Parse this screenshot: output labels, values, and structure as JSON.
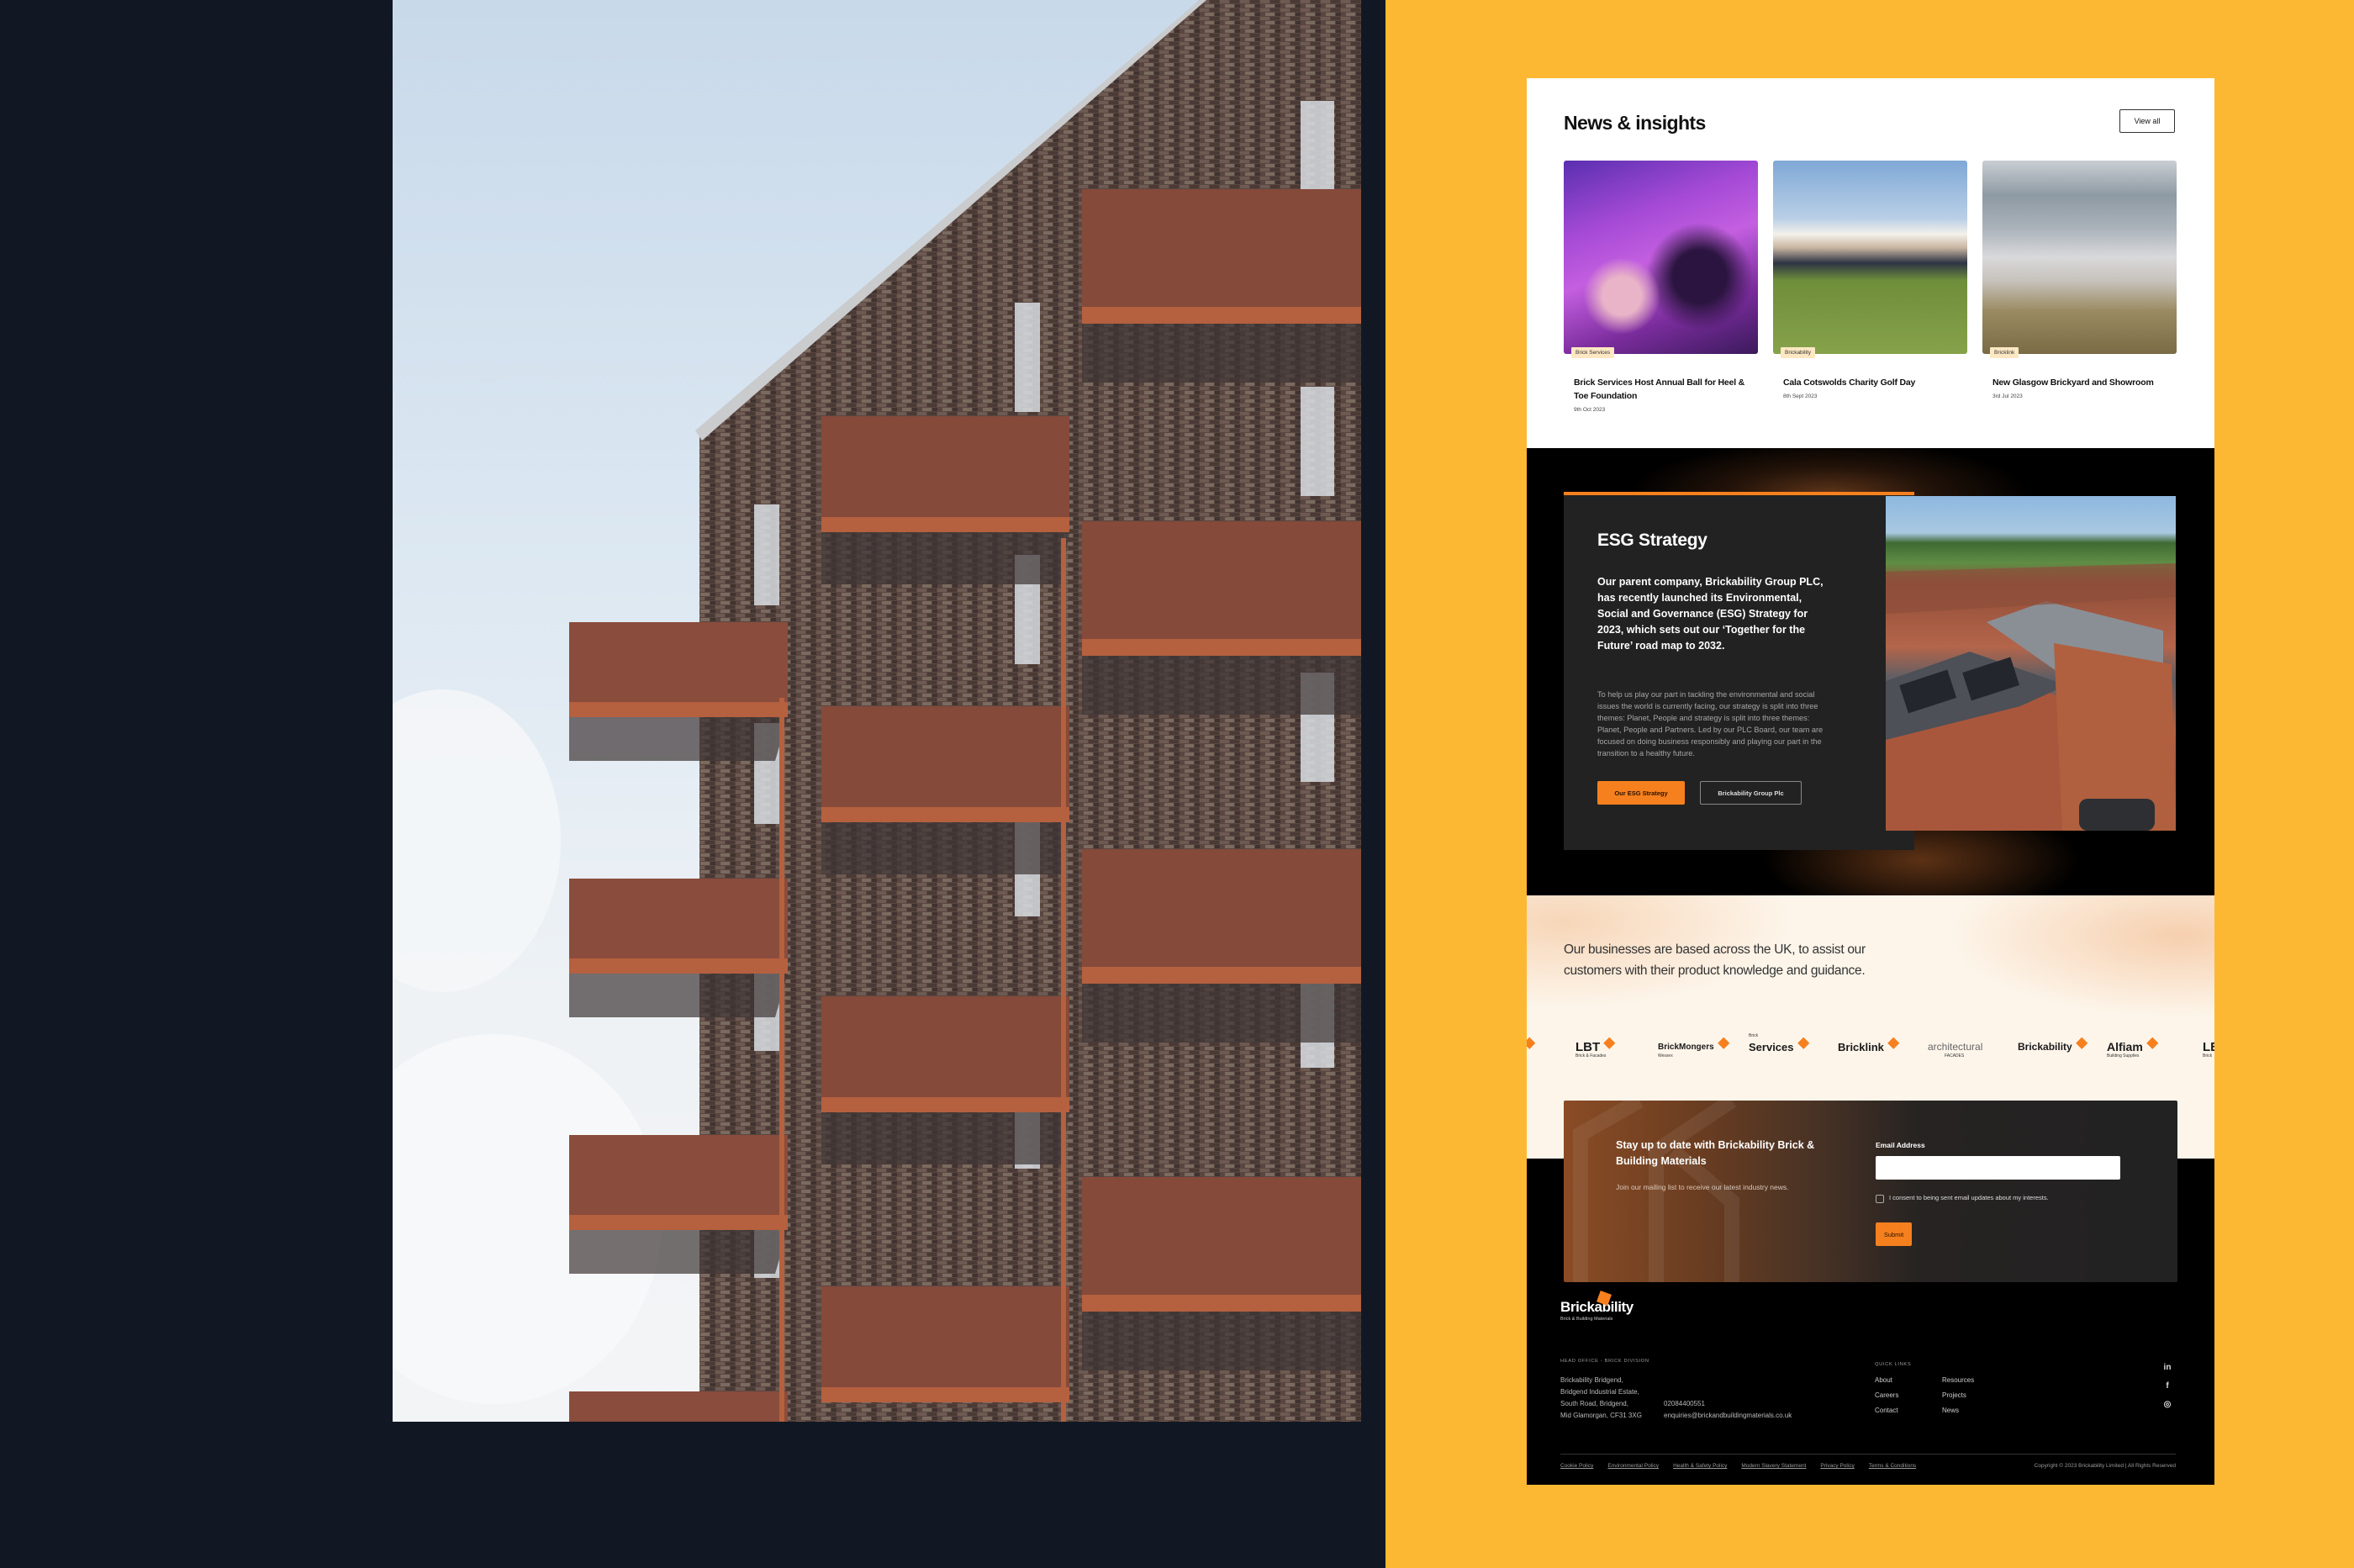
{
  "news": {
    "title": "News & insights",
    "view_all_label": "View all",
    "cards": [
      {
        "tag": "Brick Services",
        "title": "Brick Services Host Annual Ball for Heel & Toe Foundation",
        "date": "9th Oct 2023"
      },
      {
        "tag": "Brickability",
        "title": "Cala Cotswolds Charity Golf Day",
        "date": "8th Sept 2023"
      },
      {
        "tag": "Bricklink",
        "title": "New Glasgow Brickyard and Showroom",
        "date": "3rd Jul 2023"
      }
    ]
  },
  "esg": {
    "heading": "ESG Strategy",
    "lead": "Our parent company, Brickability Group PLC, has recently launched its Environmental, Social and Governance (ESG) Strategy for 2023, which sets out our ‘Together for the Future’ road map to 2032.",
    "body": "To help us play our part in tackling the environmental and social issues the world is currently facing, our strategy is split into three themes: Planet, People and strategy is split into three themes: Planet, People and Partners. Led by our PLC Board, our team are focused on doing business responsibly and playing our part in the transition to a healthy future.",
    "primary_button": "Our ESG Strategy",
    "secondary_button": "Brickability Group Plc"
  },
  "businesses": {
    "text": "Our businesses are based across the UK, to assist our customers with their product knowledge and guidance.",
    "logos": [
      {
        "name": "LBT",
        "sub": "Brick & Facades"
      },
      {
        "name": "BrickMongers",
        "sub": "Wessex"
      },
      {
        "name": "Services",
        "sub": "Brick"
      },
      {
        "name": "Bricklink",
        "sub": ""
      },
      {
        "name": "architectural",
        "sub": "FACADES"
      },
      {
        "name": "Brickability",
        "sub": ""
      },
      {
        "name": "Alfiam",
        "sub": "Building Supplies"
      },
      {
        "name": "LBT",
        "sub": "Brick"
      }
    ]
  },
  "newsletter": {
    "title": "Stay up to date with Brickability Brick & Building Materials",
    "subtitle": "Join our mailing list to receive our latest industry news.",
    "email_label": "Email Address",
    "email_value": "",
    "consent_label": "I consent to being sent email updates about my interests.",
    "submit_label": "Submit"
  },
  "footer": {
    "logo_name": "Brickability",
    "logo_sub": "Brick & Building Materials",
    "head_office_label": "HEAD OFFICE - BRICK DIVISION",
    "address_lines": [
      "Brickability Bridgend,",
      "Bridgend Industrial Estate,",
      "South Road, Bridgend,",
      "Mid Glamorgan, CF31 3XG"
    ],
    "phone": "02084400551",
    "email": "enquiries@brickandbuildingmaterials.co.uk",
    "quick_links_label": "QUICK LINKS",
    "quick_links": [
      "About",
      "Resources",
      "Careers",
      "Projects",
      "Contact",
      "News"
    ],
    "social": [
      {
        "icon": "linkedin-icon",
        "glyph": "in"
      },
      {
        "icon": "facebook-icon",
        "glyph": "f"
      },
      {
        "icon": "instagram-icon",
        "glyph": "◎"
      }
    ],
    "legal_links": [
      "Cookie Policy",
      "Environmental Policy",
      "Health & Safety Policy",
      "Modern Slavery Statement",
      "Privacy Policy",
      "Terms & Conditions"
    ],
    "copyright": "Copyright © 2023 Brickability Limited | All Rights Reserved"
  },
  "colors": {
    "accent_orange": "#f6801e",
    "background_yellow": "#fdb833",
    "background_navy": "#111823"
  }
}
